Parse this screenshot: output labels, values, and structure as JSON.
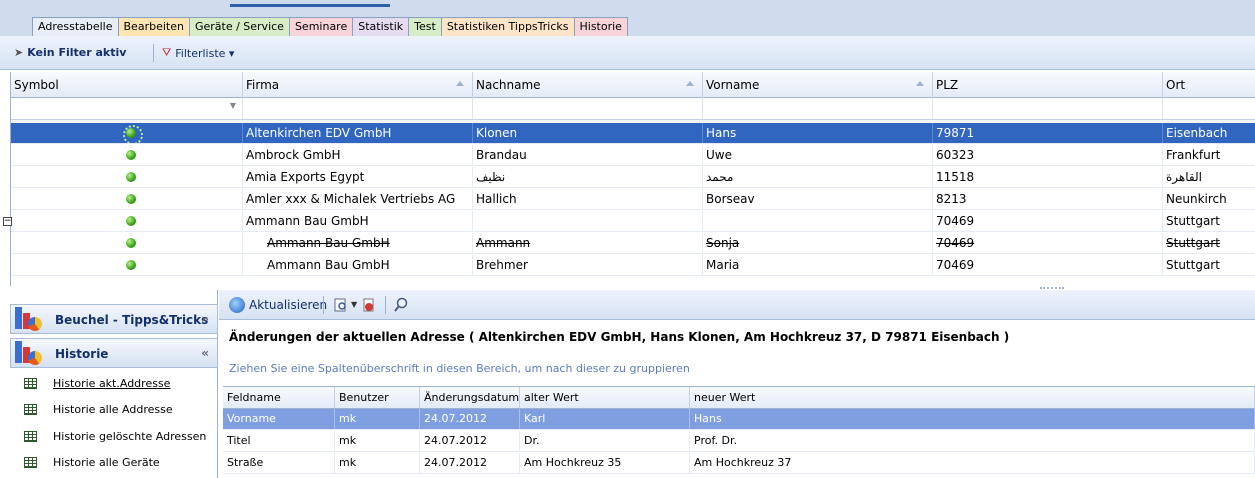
{
  "tabs": [
    "Adresstabelle",
    "Bearbeiten",
    "Geräte / Service",
    "Seminare",
    "Statistik",
    "Test",
    "Statistiken TippsTricks",
    "Historie"
  ],
  "filterbar": {
    "no_filter_label": "Kein Filter aktiv",
    "filterlist_label": "Filterliste ▾"
  },
  "grid": {
    "columns": [
      "Symbol",
      "Firma",
      "Nachname",
      "Vorname",
      "PLZ",
      "Ort"
    ],
    "rows": [
      {
        "firma": "Altenkirchen EDV GmbH",
        "nachname": "Klonen",
        "vorname": "Hans",
        "plz": "79871",
        "ort": "Eisenbach"
      },
      {
        "firma": "Ambrock GmbH",
        "nachname": "Brandau",
        "vorname": "Uwe",
        "plz": "60323",
        "ort": "Frankfurt"
      },
      {
        "firma": "Amia Exports Egypt",
        "nachname": "نظيف",
        "vorname": "محمد",
        "plz": "11518",
        "ort": "القاهرة"
      },
      {
        "firma": "Amler xxx & Michalek Vertriebs AG",
        "nachname": "Hallich",
        "vorname": "Borseav",
        "plz": "8213",
        "ort": "Neunkirch"
      },
      {
        "firma": "Ammann Bau GmbH",
        "nachname": "",
        "vorname": "",
        "plz": "70469",
        "ort": "Stuttgart"
      },
      {
        "firma": "Ammann Bau GmbH",
        "nachname": "Ammann",
        "vorname": "Sonja",
        "plz": "70469",
        "ort": "Stuttgart"
      },
      {
        "firma": "Ammann Bau GmbH",
        "nachname": "Brehmer",
        "vorname": "Maria",
        "plz": "70469",
        "ort": "Stuttgart"
      }
    ]
  },
  "nav": {
    "tips_header": "Beuchel - Tipps&Tricks",
    "history_header": "Historie",
    "items": [
      "Historie akt.Addresse",
      "Historie alle Addresse",
      "Historie gelöschte Adressen",
      "Historie alle Geräte"
    ]
  },
  "history": {
    "refresh_label": "Aktualisieren",
    "title": "Änderungen der aktuellen Adresse  ( Altenkirchen EDV GmbH, Hans Klonen, Am Hochkreuz 37, D 79871 Eisenbach )",
    "group_hint": "Ziehen Sie eine Spaltenüberschrift in diesen Bereich, um nach dieser zu gruppieren",
    "columns": [
      "Feldname",
      "Benutzer",
      "Änderungsdatum",
      "alter Wert",
      "neuer Wert"
    ],
    "rows": [
      {
        "feld": "Vorname",
        "benutzer": "mk",
        "datum": "24.07.2012",
        "alt": "Karl",
        "neu": "Hans"
      },
      {
        "feld": "Titel",
        "benutzer": "mk",
        "datum": "24.07.2012",
        "alt": "Dr.",
        "neu": "Prof. Dr."
      },
      {
        "feld": "Straße",
        "benutzer": "mk",
        "datum": "24.07.2012",
        "alt": "Am Hochkreuz 35",
        "neu": "Am Hochkreuz 37"
      }
    ]
  },
  "colors": {
    "selection": "#3166c0",
    "history_selection": "#7f9fe0",
    "accent": "#14306c"
  }
}
